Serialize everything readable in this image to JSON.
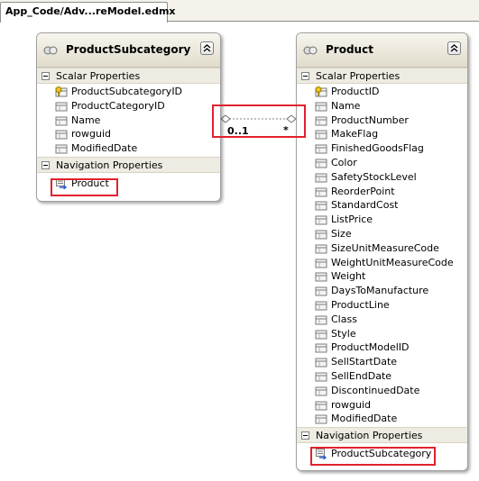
{
  "tab": {
    "title": "App_Code/Adv...reModel.edmx"
  },
  "colors": {
    "callout": "#e2212c",
    "header_top": "#f7f5ee",
    "header_bottom": "#e1dccb"
  },
  "subcategory": {
    "title": "ProductSubcategory",
    "collapse_icon": "double-chevron-up-icon",
    "scalar_label": "Scalar Properties",
    "scalar": [
      {
        "name": "ProductSubcategoryID",
        "key": true
      },
      {
        "name": "ProductCategoryID",
        "key": false
      },
      {
        "name": "Name",
        "key": false
      },
      {
        "name": "rowguid",
        "key": false
      },
      {
        "name": "ModifiedDate",
        "key": false
      }
    ],
    "nav_label": "Navigation Properties",
    "nav": [
      "Product"
    ]
  },
  "product": {
    "title": "Product",
    "collapse_icon": "double-chevron-up-icon",
    "scalar_label": "Scalar Properties",
    "scalar": [
      {
        "name": "ProductID",
        "key": true
      },
      {
        "name": "Name",
        "key": false
      },
      {
        "name": "ProductNumber",
        "key": false
      },
      {
        "name": "MakeFlag",
        "key": false
      },
      {
        "name": "FinishedGoodsFlag",
        "key": false
      },
      {
        "name": "Color",
        "key": false
      },
      {
        "name": "SafetyStockLevel",
        "key": false
      },
      {
        "name": "ReorderPoint",
        "key": false
      },
      {
        "name": "StandardCost",
        "key": false
      },
      {
        "name": "ListPrice",
        "key": false
      },
      {
        "name": "Size",
        "key": false
      },
      {
        "name": "SizeUnitMeasureCode",
        "key": false
      },
      {
        "name": "WeightUnitMeasureCode",
        "key": false
      },
      {
        "name": "Weight",
        "key": false
      },
      {
        "name": "DaysToManufacture",
        "key": false
      },
      {
        "name": "ProductLine",
        "key": false
      },
      {
        "name": "Class",
        "key": false
      },
      {
        "name": "Style",
        "key": false
      },
      {
        "name": "ProductModelID",
        "key": false
      },
      {
        "name": "SellStartDate",
        "key": false
      },
      {
        "name": "SellEndDate",
        "key": false
      },
      {
        "name": "DiscontinuedDate",
        "key": false
      },
      {
        "name": "rowguid",
        "key": false
      },
      {
        "name": "ModifiedDate",
        "key": false
      }
    ],
    "nav_label": "Navigation Properties",
    "nav": [
      "ProductSubcategory"
    ]
  },
  "association": {
    "left_multiplicity": "0..1",
    "right_multiplicity": "*"
  }
}
